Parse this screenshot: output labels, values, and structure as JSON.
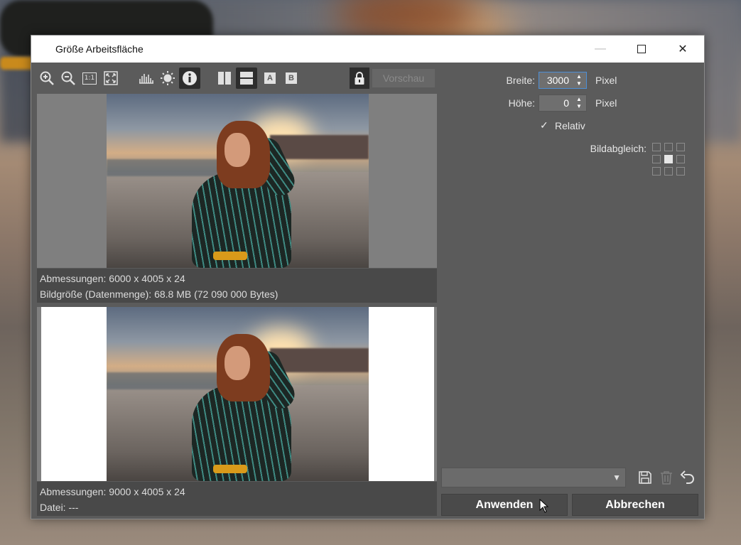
{
  "window": {
    "title": "Größe Arbeitsfläche",
    "controls": {
      "minimize": "—",
      "maximize": "",
      "close": "✕"
    }
  },
  "toolbar": {
    "items": [
      {
        "name": "zoom-in-icon"
      },
      {
        "name": "zoom-out-icon"
      },
      {
        "name": "actual-size-icon",
        "label": "1:1"
      },
      {
        "name": "fit-window-icon"
      },
      {
        "name": "histogram-icon"
      },
      {
        "name": "brightness-icon"
      },
      {
        "name": "info-icon",
        "active": true
      },
      {
        "name": "split-vertical-icon"
      },
      {
        "name": "split-horizontal-icon",
        "active": true
      },
      {
        "name": "view-a-icon",
        "label": "A"
      },
      {
        "name": "view-b-icon",
        "label": "B"
      }
    ],
    "lock_active": true,
    "preview_label": "Vorschau"
  },
  "original": {
    "dimensions": "Abmessungen: 6000 x 4005 x 24",
    "size": "Bildgröße (Datenmenge): 68.8 MB (72 090 000 Bytes)"
  },
  "result": {
    "dimensions": "Abmessungen: 9000 x 4005 x 24",
    "file": "Datei:  ---"
  },
  "settings": {
    "width_label": "Breite:",
    "width_value": "3000",
    "width_unit": "Pixel",
    "height_label": "Höhe:",
    "height_value": "0",
    "height_unit": "Pixel",
    "relative_label": "Relativ",
    "relative_checked": true,
    "check_mark": "✓",
    "alignment_label": "Bildabgleich:",
    "alignment_selected": "center"
  },
  "presets": {
    "selected": "",
    "save_icon": "save-icon",
    "delete_icon": "trash-icon",
    "reset_icon": "undo-icon"
  },
  "buttons": {
    "apply": "Anwenden",
    "cancel": "Abbrechen"
  },
  "colors": {
    "panel": "#5b5b5b",
    "focus": "#4c8fd6"
  }
}
